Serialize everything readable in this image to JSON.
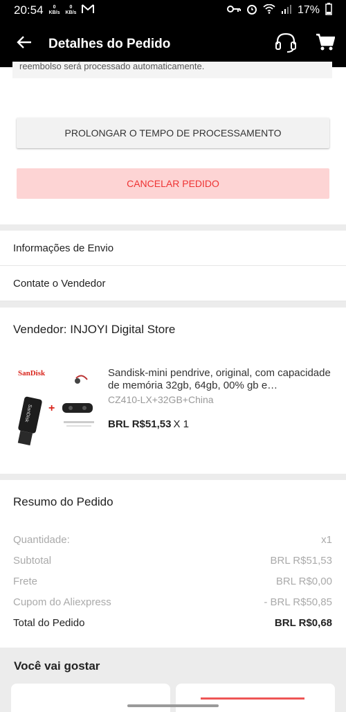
{
  "status_bar": {
    "time": "20:54",
    "net1_value": "0",
    "net1_unit": "KB/s",
    "net2_value": "0",
    "net2_unit": "KB/s",
    "battery": "17%"
  },
  "app_bar": {
    "title": "Detalhes do Pedido"
  },
  "partial_note": "reembolso será processado automaticamente.",
  "actions": {
    "extend_label": "PROLONGAR O TEMPO DE PROCESSAMENTO",
    "cancel_label": "CANCELAR PEDIDO"
  },
  "links": {
    "shipping": "Informações de Envio",
    "contact": "Contate o Vendedor"
  },
  "seller": {
    "title": "Vendedor: INJOYI Digital Store",
    "product": {
      "title": "Sandisk-mini pendrive, original, com capacidade de memória 32gb, 64gb, 00% gb e…",
      "variant": "CZ410-LX+32GB+China",
      "price": "BRL R$51,53",
      "qty": "X 1"
    }
  },
  "summary": {
    "title": "Resumo do Pedido",
    "quantity_label": "Quantidade:",
    "quantity_value": "x1",
    "subtotal_label": "Subtotal",
    "subtotal_value": "BRL R$51,53",
    "shipping_label": "Frete",
    "shipping_value": "BRL R$0,00",
    "coupon_label": "Cupom do Aliexpress",
    "coupon_value": "- BRL R$50,85",
    "total_label": "Total do Pedido",
    "total_value": "BRL R$0,68"
  },
  "recommend": {
    "title": "Você vai gostar"
  },
  "colors": {
    "cancel_bg": "#fdd4d4",
    "cancel_text": "#ee3333"
  }
}
